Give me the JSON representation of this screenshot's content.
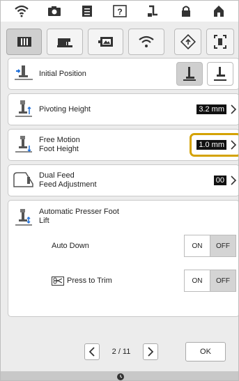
{
  "colors": {
    "highlight": "#d4a200",
    "value_bg": "#111111",
    "toggle_selected": "#d4d4d4"
  },
  "statusbar": {
    "icons": [
      "wifi-icon",
      "camera-icon",
      "document-icon",
      "help-icon",
      "thread-icon",
      "lock-icon",
      "home-icon"
    ]
  },
  "tabs": [
    {
      "icon": "sewing-settings-icon",
      "active": true
    },
    {
      "icon": "machine-settings-icon",
      "active": false
    },
    {
      "icon": "display-settings-icon",
      "active": false
    },
    {
      "icon": "wifi-settings-icon",
      "active": false
    },
    {
      "icon": "info-icon",
      "active": false
    },
    {
      "icon": "screen-capture-icon",
      "active": false
    }
  ],
  "settings": {
    "initial_position": {
      "label": "Initial Position"
    },
    "pivoting_height": {
      "label": "Pivoting Height",
      "value": "3.2 mm"
    },
    "free_motion": {
      "label": "Free Motion\nFoot Height",
      "value": "1.0 mm"
    },
    "dual_feed": {
      "label": "Dual Feed\nFeed Adjustment",
      "value": "00"
    },
    "auto_lift": {
      "label": "Automatic Presser Foot\nLift",
      "auto_down": {
        "label": "Auto Down",
        "on": "ON",
        "off": "OFF",
        "selected": "OFF"
      },
      "press_to_trim": {
        "label": "Press to Trim",
        "on": "ON",
        "off": "OFF",
        "selected": "OFF"
      }
    }
  },
  "pager": {
    "text": "2 / 11"
  },
  "ok_label": "OK"
}
